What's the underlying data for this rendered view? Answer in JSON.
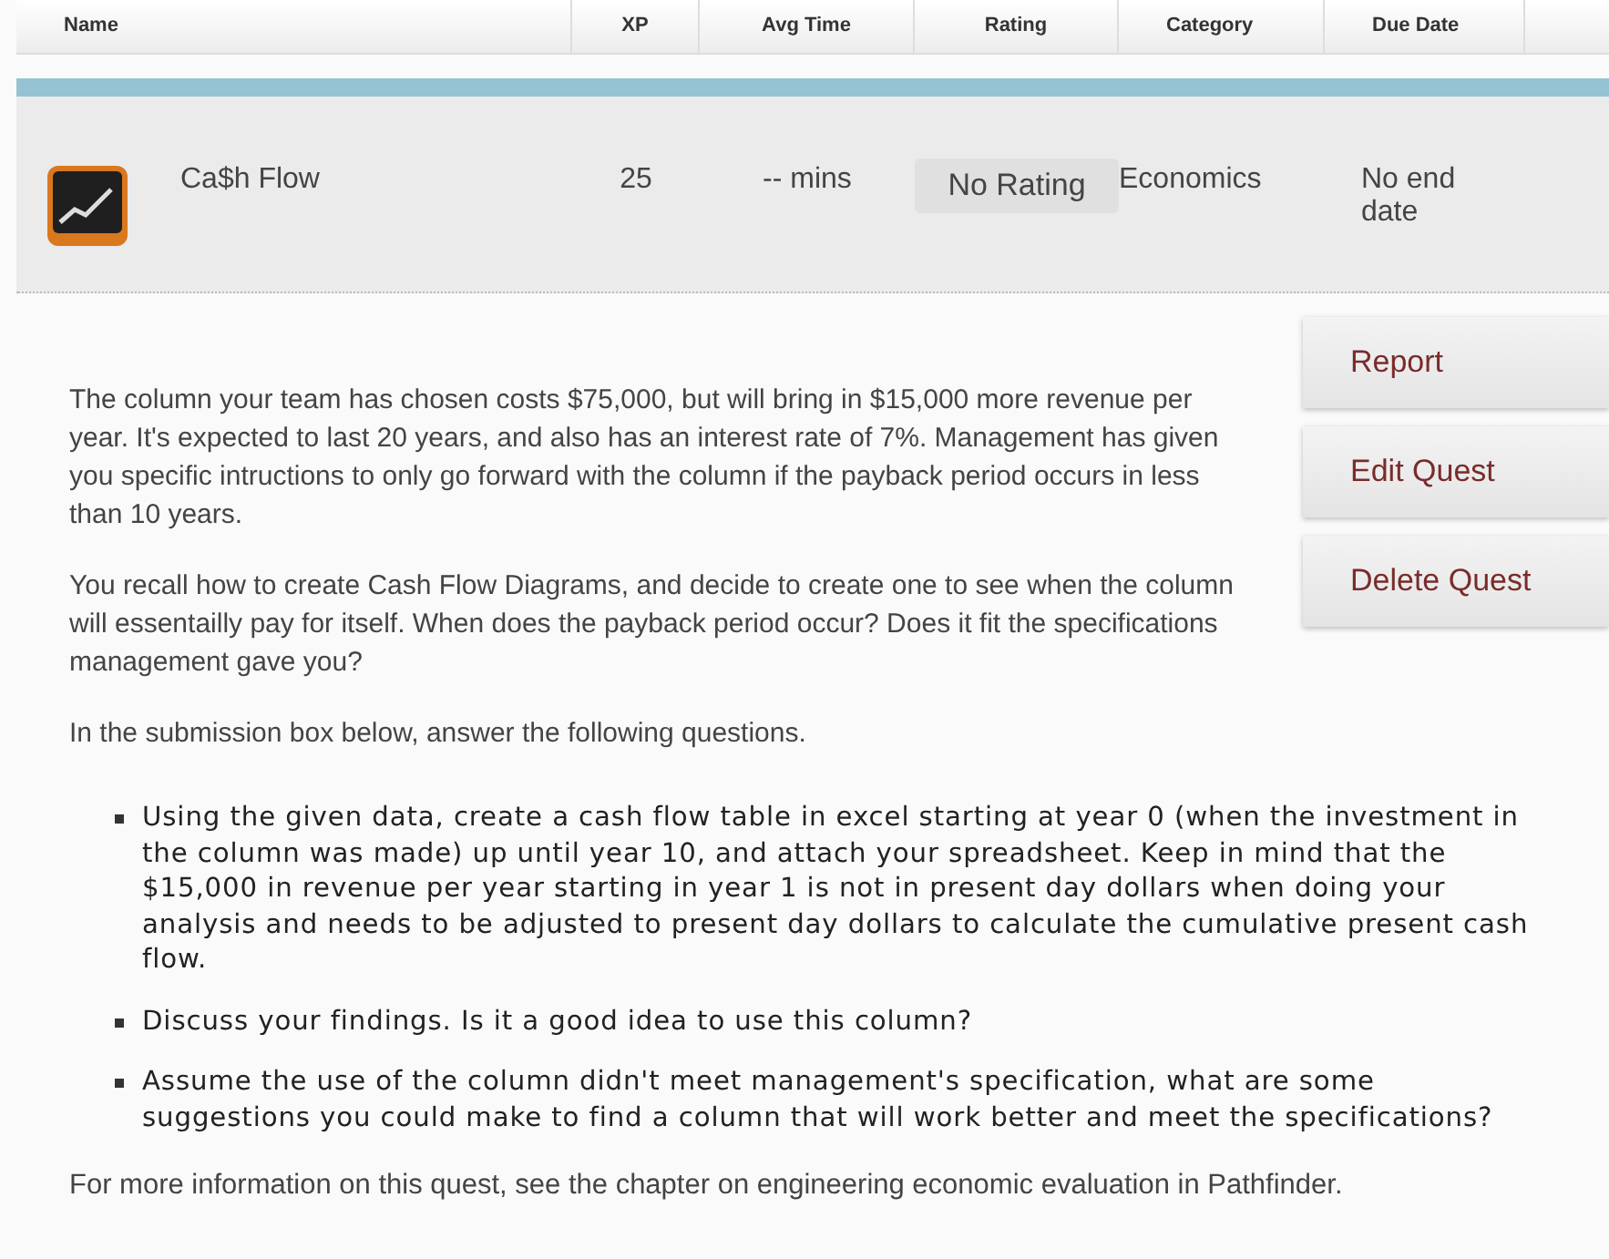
{
  "table": {
    "columns": [
      "Name",
      "XP",
      "Avg Time",
      "Rating",
      "Category",
      "Due Date"
    ],
    "row": {
      "name": "Ca$h Flow",
      "xp": "25",
      "avg_time": "-- mins",
      "rating": "No Rating",
      "category": "Economics",
      "due_date": "No end date"
    }
  },
  "actions": [
    "Report",
    "Edit Quest",
    "Delete Quest"
  ],
  "paragraphs": [
    "The column your team has chosen costs $75,000, but will bring in $15,000 more revenue per year. It's expected to last 20 years, and also has an interest rate of 7%. Management has given you specific intructions to only go forward with the column if the payback period occurs in less than 10 years.",
    "You recall how to create Cash Flow Diagrams, and decide to create one to see when the column will essentailly pay for itself. When does the payback period occur? Does it fit the specifications management gave you?",
    "In the submission box below, answer the following questions."
  ],
  "questions": [
    [
      "Using the given data, create a cash flow table in excel starting at year 0 (when the investment in",
      "the column was made) up until year 10, and attach your spreadsheet.  Keep in mind that the",
      "$15,000 in revenue per year starting in year 1 is not in present day dollars when doing your",
      "analysis and needs to be adjusted to present day dollars to calculate the cumulative present cash",
      "flow."
    ],
    [
      "Discuss your findings. Is it a good idea to use this column?"
    ],
    [
      "Assume the use of the column didn't meet management's specification, what are some",
      "suggestions you could make to find a column that will work better and meet the specifications?"
    ]
  ],
  "footer": "For more information on this quest, see the chapter on engineering economic evaluation in Pathfinder."
}
